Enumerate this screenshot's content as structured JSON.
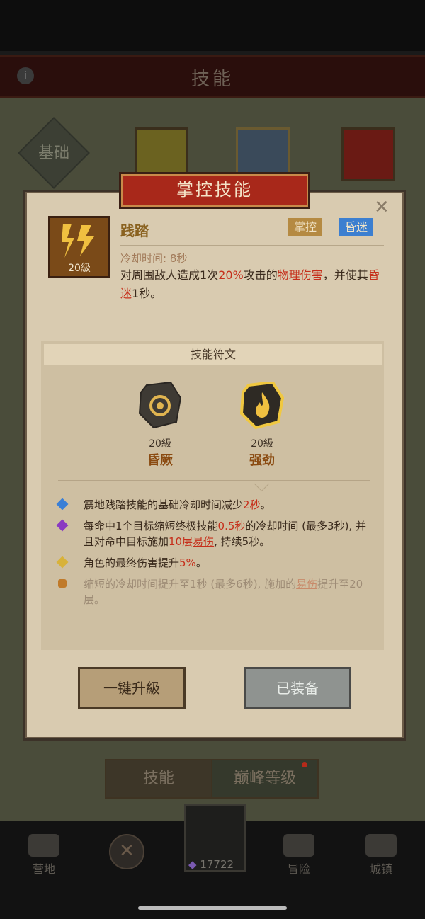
{
  "header": {
    "title": "技能",
    "info_glyph": "i"
  },
  "skill_tree": {
    "basic_tab": "基础"
  },
  "modal": {
    "banner": "掌控技能",
    "close_glyph": "✕",
    "skill": {
      "name": "践踏",
      "level": "20級",
      "tags": [
        {
          "label": "掌控",
          "color": "#b58a42"
        },
        {
          "label": "昏迷",
          "color": "#3c7fd0"
        }
      ],
      "cooldown": "冷却时间: 8秒",
      "desc": [
        "对周围敌人造成1次",
        "20%",
        "攻击的",
        "物理伤害",
        "，并使其",
        "昏迷",
        "1秒。"
      ]
    },
    "runes": {
      "heading": "技能符文",
      "items": [
        {
          "level": "20級",
          "name": "昏厥",
          "selected": false
        },
        {
          "level": "20級",
          "name": "强劲",
          "selected": true
        }
      ],
      "effects": [
        {
          "color": "#3a7fd6",
          "parts": [
            "震地践踏技能的基础冷却时间减少",
            "2秒",
            "。"
          ]
        },
        {
          "color": "#8a3ac2",
          "parts": [
            "每命中1个目标缩短终极技能",
            "0.5秒",
            "的冷却时间 (最多3秒), 并且对命中目标施加",
            "10层",
            "易伤",
            ", 持续5秒。"
          ]
        },
        {
          "color": "#d8b23a",
          "parts": [
            "角色的最终伤害提升",
            "5%",
            "。"
          ]
        },
        {
          "color": "#c07a2a",
          "locked": true,
          "parts": [
            "缩短的冷却时间提升至1秒 (最多6秒), 施加的",
            "易伤",
            "提升至20层。"
          ]
        }
      ]
    },
    "buttons": {
      "upgrade": "一键升級",
      "equipped": "已装备"
    }
  },
  "bottom_tabs": {
    "skills": "技能",
    "peak": "巅峰等级"
  },
  "nav": {
    "camp": "营地",
    "adventure": "冒险",
    "castle": "城镇",
    "currency": "17722"
  },
  "colors": {
    "accent_red": "#c62f1b",
    "modal_bg": "#d9cbb0",
    "banner": "#a8281a"
  }
}
